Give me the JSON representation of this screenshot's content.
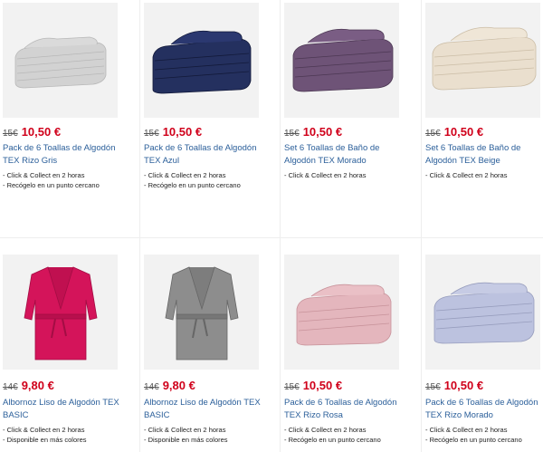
{
  "colors": {
    "price_red": "#d0011b",
    "title_blue": "#2b5f9a"
  },
  "products": [
    {
      "old_price": "15€",
      "price": "10,50 €",
      "title": "Pack de 6 Toallas de Algodón TEX Rizo Gris",
      "features": [
        "- Click & Collect en 2 horas",
        "- Recógelo en un punto cercano"
      ],
      "image": "grey-towel-stack",
      "swatch": "#cfcfcf"
    },
    {
      "old_price": "15€",
      "price": "10,50 €",
      "title": "Pack de 6 Toallas de Algodón TEX Azul",
      "features": [
        "- Click & Collect en 2 horas",
        "- Recógelo en un punto cercano"
      ],
      "image": "navy-towel-stack",
      "swatch": "#1f2c5e"
    },
    {
      "old_price": "15€",
      "price": "10,50 €",
      "title": "Set 6 Toallas de Baño de Algodón TEX Morado",
      "features": [
        "- Click & Collect en 2 horas"
      ],
      "image": "purple-towel-stack",
      "swatch": "#6b4f72"
    },
    {
      "old_price": "15€",
      "price": "10,50 €",
      "title": "Set 6 Toallas de Baño de Algodón TEX Beige",
      "features": [
        "- Click & Collect en 2 horas"
      ],
      "image": "beige-towel-stack",
      "swatch": "#e8dccb"
    },
    {
      "old_price": "14€",
      "price": "9,80 €",
      "title": "Albornoz Liso de Algodón TEX BASIC",
      "features": [
        "- Click & Collect en 2 horas",
        "- Disponible en más colores"
      ],
      "image": "pink-bathrobe",
      "swatch": "#d4145a"
    },
    {
      "old_price": "14€",
      "price": "9,80 €",
      "title": "Albornoz Liso de Algodón TEX BASIC",
      "features": [
        "- Click & Collect en 2 horas",
        "- Disponible en más colores"
      ],
      "image": "grey-bathrobe",
      "swatch": "#8a8a8a"
    },
    {
      "old_price": "15€",
      "price": "10,50 €",
      "title": "Pack de 6 Toallas de Algodón TEX Rizo Rosa",
      "features": [
        "- Click & Collect en 2 horas",
        "- Recógelo en un punto cercano"
      ],
      "image": "pink-towel-stack",
      "swatch": "#e3b3bb"
    },
    {
      "old_price": "15€",
      "price": "10,50 €",
      "title": "Pack de 6 Toallas de Algodón TEX Rizo Morado",
      "features": [
        "- Click & Collect en 2 horas",
        "- Recógelo en un punto cercano"
      ],
      "image": "lavender-towel-stack",
      "swatch": "#b9bfdc"
    }
  ]
}
